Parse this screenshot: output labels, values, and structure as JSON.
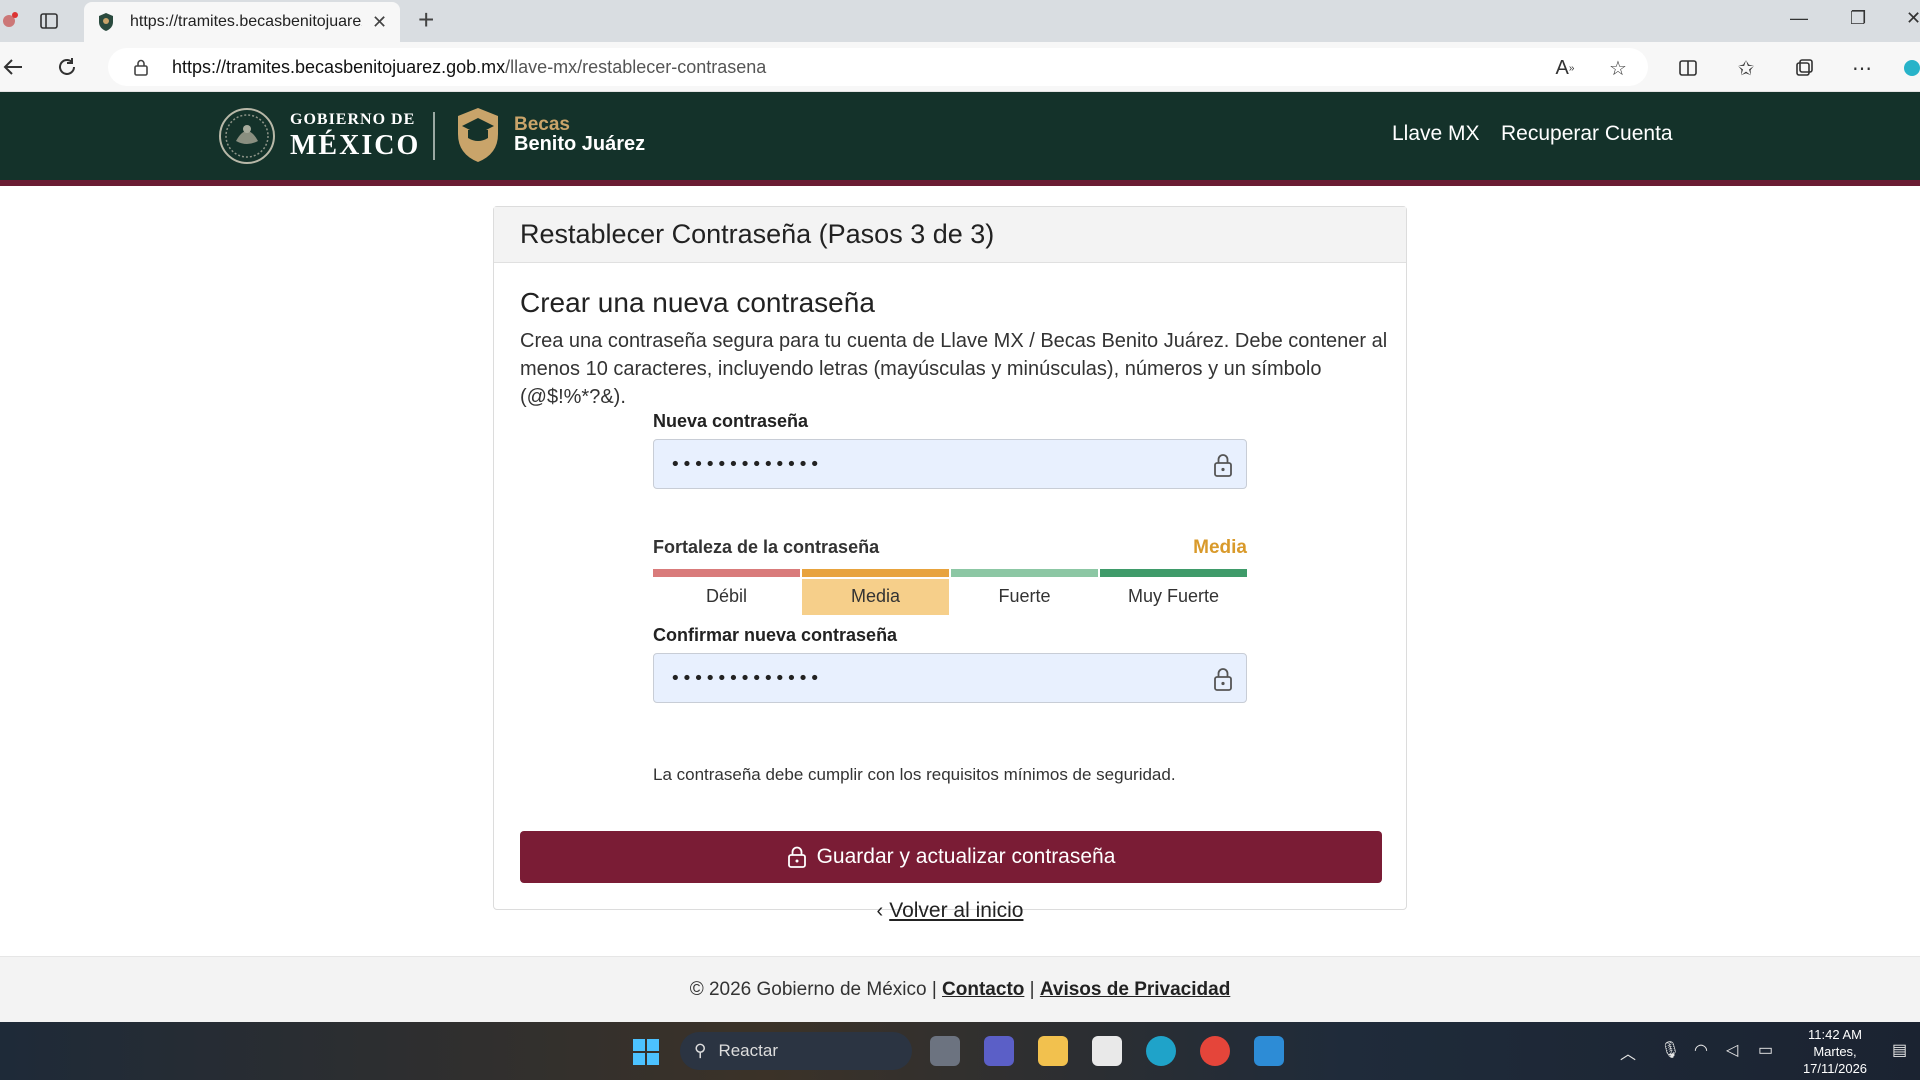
{
  "browser": {
    "tab_title": "https://tramites.becasbenitojuarez",
    "url_host": "https://tramites.becasbenitojuarez.gob.mx",
    "url_path": "/llave-mx/restablecer-contrasena"
  },
  "header": {
    "gob_line1": "GOBIERNO DE",
    "gob_line2": "MÉXICO",
    "becas_line1": "Becas",
    "becas_line2": "Benito Juárez",
    "nav": [
      "Llave MX",
      "Recuperar Cuenta"
    ]
  },
  "card": {
    "header": "Restablecer Contraseña (Pasos 3 de 3)",
    "title": "Crear una nueva contraseña",
    "description": "Crea una contraseña segura para tu cuenta de Llave MX / Becas Benito Juárez. Debe contener al menos 10 caracteres, incluyendo letras (mayúsculas y minúsculas), números y un símbolo (@$!%*?&).",
    "new_password": {
      "label": "Nueva contraseña",
      "value": "•••••••••••••"
    },
    "strength": {
      "label": "Fortaleza de la contraseña",
      "value": "Media",
      "levels": [
        "Débil",
        "Media",
        "Fuerte",
        "Muy Fuerte"
      ],
      "active_level": 1,
      "colors": [
        "#d97b7b",
        "#e8a33d",
        "#8cc7a4",
        "#3f9b6a"
      ]
    },
    "confirm_password": {
      "label": "Confirmar nueva contraseña",
      "value": "•••••••••••••"
    },
    "hint": "La contraseña debe cumplir con los requisitos mínimos de seguridad.",
    "submit_label": "Guardar y actualizar contraseña",
    "back_label": "Volver al inicio"
  },
  "footer": {
    "copyright": "© 2026 Gobierno de México |",
    "contact": "Contacto",
    "separator": "|",
    "privacy": "Avisos de Privacidad"
  },
  "taskbar": {
    "search_placeholder": "Reactar",
    "time": "11:42 AM",
    "day": "Martes,",
    "date": "17/11/2026"
  },
  "colors": {
    "header_bg": "#14322a",
    "accent_red": "#6b1d33",
    "button_bg": "#7a1c35",
    "strength_media": "#d99a2b"
  }
}
